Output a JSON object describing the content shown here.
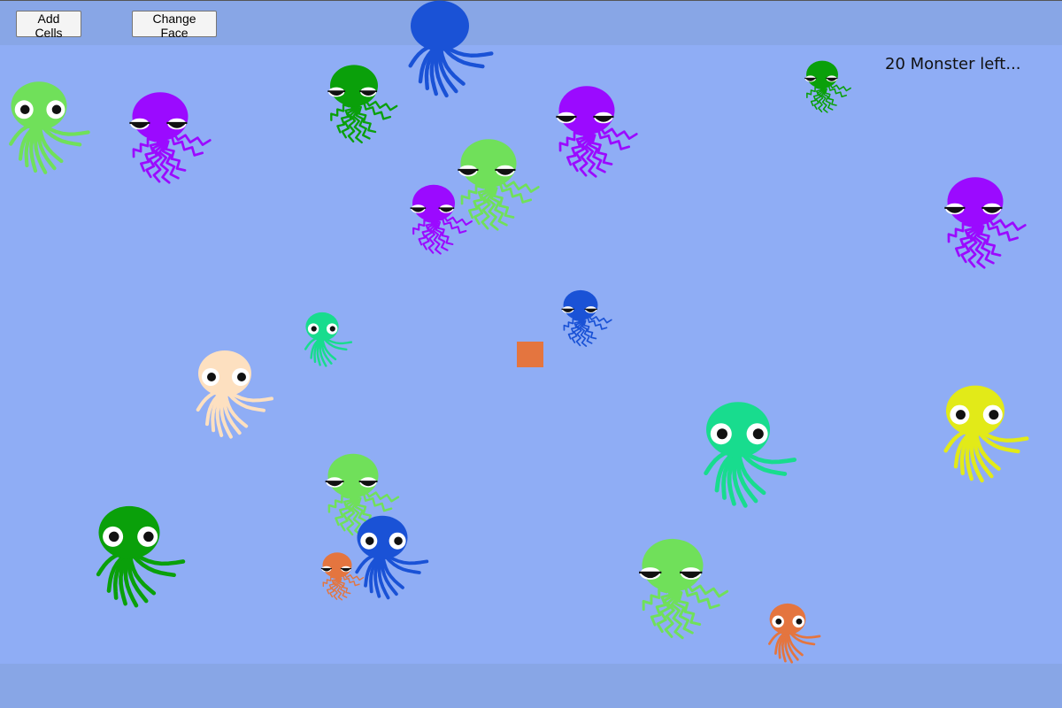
{
  "toolbar": {
    "add_cells_label": "Add Cells",
    "change_face_label": "Change Face"
  },
  "status": {
    "text": "20 Monster left..."
  },
  "colors": {
    "background": "#8fadf5",
    "bar": "#88a6e6",
    "player": "#e4753f"
  },
  "monsters": [
    {
      "color": "#1a52d6",
      "face": "none",
      "style": "smooth"
    },
    {
      "color": "#70e05a",
      "face": "round",
      "style": "smooth"
    },
    {
      "color": "#9b0aff",
      "face": "sleepy",
      "style": "zigzag"
    },
    {
      "color": "#0aa00a",
      "face": "sleepy",
      "style": "zigzag"
    },
    {
      "color": "#9b0aff",
      "face": "sleepy",
      "style": "zigzag"
    },
    {
      "color": "#70e05a",
      "face": "sleepy",
      "style": "zigzag"
    },
    {
      "color": "#9b0aff",
      "face": "sleepy",
      "style": "zigzag"
    },
    {
      "color": "#0aa00a",
      "face": "sleepy",
      "style": "zigzag"
    },
    {
      "color": "#9b0aff",
      "face": "sleepy",
      "style": "zigzag"
    },
    {
      "color": "#1a52d6",
      "face": "sleepy",
      "style": "zigzag"
    },
    {
      "color": "#18dc8e",
      "face": "round",
      "style": "smooth"
    },
    {
      "color": "#fde0c0",
      "face": "round",
      "style": "smooth"
    },
    {
      "color": "#18dc8e",
      "face": "round",
      "style": "smooth"
    },
    {
      "color": "#e2ea18",
      "face": "round",
      "style": "smooth"
    },
    {
      "color": "#70e05a",
      "face": "sleepy",
      "style": "zigzag"
    },
    {
      "color": "#0aa00a",
      "face": "round",
      "style": "smooth"
    },
    {
      "color": "#1a52d6",
      "face": "round",
      "style": "smooth"
    },
    {
      "color": "#e4753f",
      "face": "sleepy",
      "style": "zigzag"
    },
    {
      "color": "#70e05a",
      "face": "sleepy",
      "style": "zigzag"
    },
    {
      "color": "#e4753f",
      "face": "round",
      "style": "smooth"
    }
  ]
}
